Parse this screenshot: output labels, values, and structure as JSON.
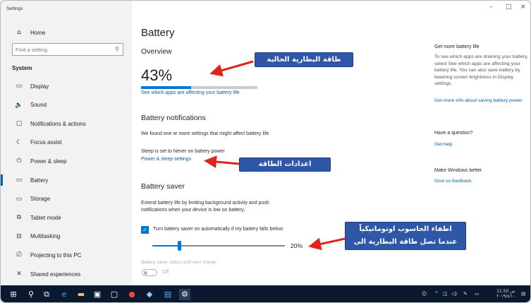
{
  "window": {
    "title": "Settings",
    "controls": [
      "–",
      "□",
      "×"
    ]
  },
  "sidebar": {
    "home": "Home",
    "search_placeholder": "Find a setting",
    "section": "System",
    "items": [
      {
        "label": "Display",
        "icon": "display-icon",
        "glyph": "▭"
      },
      {
        "label": "Sound",
        "icon": "speaker-icon",
        "glyph": "🔈"
      },
      {
        "label": "Notifications & actions",
        "icon": "notification-icon",
        "glyph": "▢"
      },
      {
        "label": "Focus assist",
        "icon": "moon-icon",
        "glyph": "☾"
      },
      {
        "label": "Power & sleep",
        "icon": "power-icon",
        "glyph": "⏻"
      },
      {
        "label": "Battery",
        "icon": "battery-icon",
        "glyph": "▭",
        "active": true
      },
      {
        "label": "Storage",
        "icon": "storage-icon",
        "glyph": "▭"
      },
      {
        "label": "Tablet mode",
        "icon": "tablet-icon",
        "glyph": "⧉"
      },
      {
        "label": "Multitasking",
        "icon": "multitasking-icon",
        "glyph": "⊟"
      },
      {
        "label": "Projecting to this PC",
        "icon": "projector-icon",
        "glyph": "⎚"
      },
      {
        "label": "Shared experiences",
        "icon": "shared-icon",
        "glyph": "✕"
      }
    ]
  },
  "main": {
    "title": "Battery",
    "overview": "Overview",
    "percent": "43%",
    "battery_level": 0.43,
    "see_apps_link": "See which apps are affecting your battery life",
    "notifications_heading": "Battery notifications",
    "notifications_text": "We found one or more settings that might affect battery life",
    "sleep_text": "Sleep is set to Never on battery power",
    "power_link": "Power & sleep settings",
    "saver_heading": "Battery saver",
    "saver_text_1": "Extend battery life by limiting background activity and push",
    "saver_text_2": "notifications when your device is low on battery.",
    "checkbox_label": "Turn battery saver on automatically if my battery falls below:",
    "slider_value": "20%",
    "slider_level": 0.2,
    "status_text": "Battery saver status until next charge",
    "toggle_label": "Off"
  },
  "right": {
    "more_life_head": "Get more battery life",
    "more_life_text": "To see which apps are draining your battery, select See which apps are affecting your battery life. You can also save battery by lowering screen brightness in Display settings.",
    "more_info_link": "Get more info about saving battery power",
    "question_head": "Have a question?",
    "help_link": "Get help",
    "better_head": "Make Windows better",
    "feedback_link": "Give us feedback"
  },
  "annotations": {
    "battery_level": "طاقة البطارية الحالية",
    "power_settings": "اعدادات الطاقة",
    "auto_off_1": "اطفاء الحاسوب اوتوماتيكياً",
    "auto_off_2": "عندما تصل طاقة البطارية الى"
  },
  "taskbar": {
    "time": "11:50 ص",
    "date": "٢٠١٩/٨/١٠"
  },
  "colors": {
    "accent": "#0078d7",
    "link": "#0063b1",
    "annotation": "#2e57a8",
    "arrow": "#e0251b",
    "taskbar": "#0a1930"
  }
}
